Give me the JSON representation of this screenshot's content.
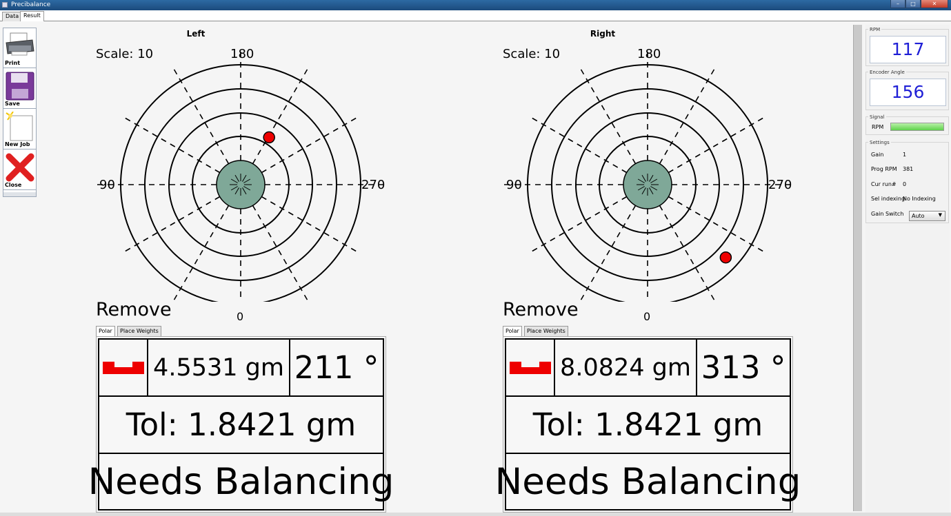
{
  "window": {
    "title": "Precibalance",
    "min_label": "–",
    "max_label": "□",
    "close_label": "✕"
  },
  "tabs": [
    {
      "label": "Data"
    },
    {
      "label": "Result"
    }
  ],
  "toolbar": {
    "print_label": "Print",
    "save_label": "Save",
    "new_job_label": "New Job",
    "close_label": "Close",
    "icons": [
      "printer-icon",
      "floppy-disk-icon",
      "new-document-icon",
      "red-x-icon"
    ]
  },
  "polar_labels": {
    "top": "180",
    "bottom": "0",
    "left": "90",
    "right": "270"
  },
  "left": {
    "title": "Left",
    "scale": "Scale: 10",
    "remove": "Remove",
    "tabs": [
      "Polar",
      "Place Weights"
    ],
    "weight": "4.5531 gm",
    "angle": "211 °",
    "tol": "Tol: 1.8421 gm",
    "status": "Needs Balancing",
    "point_angle_deg": 211
  },
  "right": {
    "title": "Right",
    "scale": "Scale: 10",
    "remove": "Remove",
    "tabs": [
      "Polar",
      "Place Weights"
    ],
    "weight": "8.0824 gm",
    "angle": "313 °",
    "tol": "Tol: 1.8421 gm",
    "status": "Needs Balancing",
    "point_angle_deg": 313
  },
  "sidebar": {
    "rpm_label": "RPM",
    "rpm_value": "117",
    "encoder_label": "Encoder Angle",
    "encoder_value": "156",
    "signal_label": "Signal",
    "signal_rpm_label": "RPM",
    "settings_label": "Settings",
    "settings": [
      {
        "key": "Gain",
        "value": "1"
      },
      {
        "key": "Prog RPM",
        "value": "381"
      },
      {
        "key": "Cur run#",
        "value": "0"
      },
      {
        "key": "Sel indexing",
        "value": "No Indexing"
      }
    ],
    "gain_switch_label": "Gain Switch",
    "gain_switch_value": "Auto"
  },
  "colors": {
    "accent_blue": "#1f1fd6",
    "point_red": "#ee0000",
    "hub_green": "#7fa898",
    "signal_green": "#5fd24b"
  }
}
